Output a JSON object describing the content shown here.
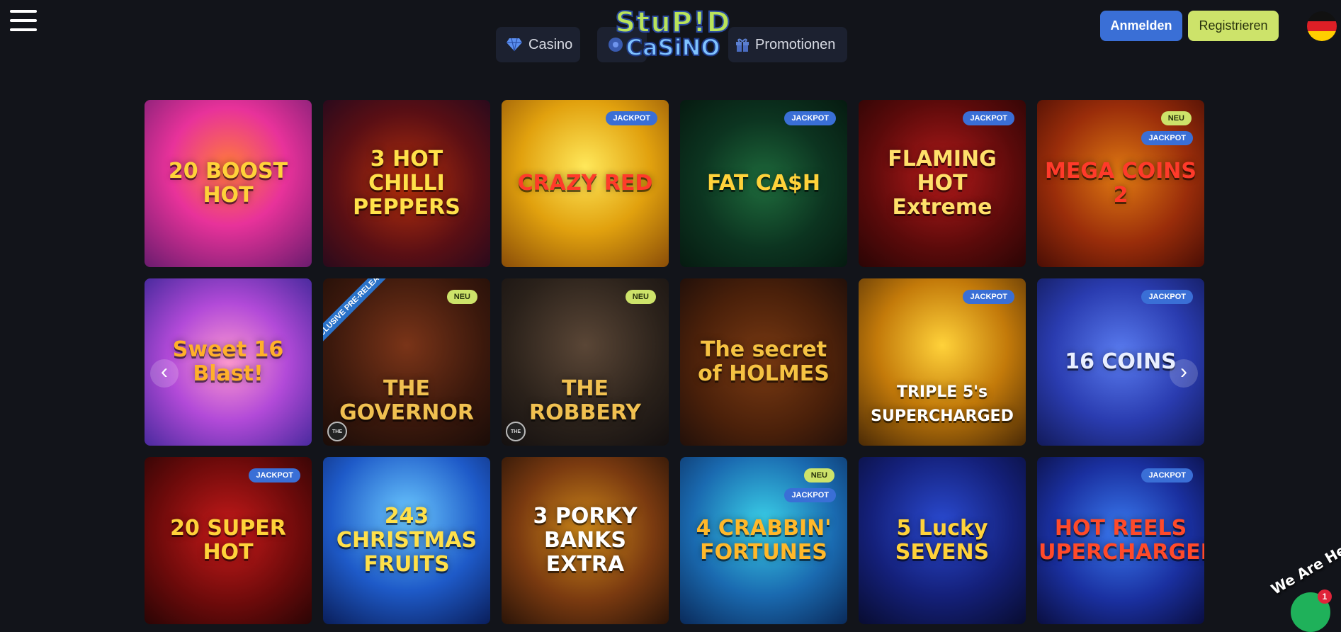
{
  "header": {
    "nav": [
      {
        "label": "Casino",
        "icon": "diamond-icon"
      },
      {
        "label": "",
        "icon": "live-icon"
      },
      {
        "label": "Promotionen",
        "icon": "gift-icon"
      }
    ],
    "logo": {
      "line1": "StuP!D",
      "line2": "CaSiNO"
    },
    "login_label": "Anmelden",
    "register_label": "Registrieren",
    "language": "German",
    "colors": {
      "accent_blue": "#3a6fd6",
      "accent_lime": "#cde36a",
      "background": "#12141a"
    }
  },
  "games": [
    {
      "title": "20 BOOST HOT",
      "badges": []
    },
    {
      "title": "3 HOT CHILLI PEPPERS",
      "badges": []
    },
    {
      "title": "CRAZY RED",
      "badges": [
        "JACKPOT"
      ]
    },
    {
      "title": "FAT CA$H",
      "badges": [
        "JACKPOT"
      ]
    },
    {
      "title": "FLAMING HOT Extreme",
      "badges": [
        "JACKPOT"
      ]
    },
    {
      "title": "MEGA COINS 2",
      "badges": [
        "NEU",
        "JACKPOT"
      ]
    },
    {
      "title": "Sweet 16 Blast!",
      "badges": []
    },
    {
      "title": "THE GOVERNOR",
      "badges": [
        "NEU"
      ],
      "ribbon": "EXCLUSIVE PRE-RELEASE"
    },
    {
      "title": "THE ROBBERY",
      "badges": [
        "NEU"
      ]
    },
    {
      "title": "The secret of HOLMES",
      "badges": []
    },
    {
      "title": "TRIPLE 5's SUPERCHARGED",
      "badges": [
        "JACKPOT"
      ]
    },
    {
      "title": "16 COINS",
      "badges": [
        "JACKPOT"
      ]
    },
    {
      "title": "20 SUPER HOT",
      "badges": [
        "JACKPOT"
      ]
    },
    {
      "title": "243 CHRISTMAS FRUITS",
      "badges": []
    },
    {
      "title": "3 PORKY BANKS EXTRA",
      "badges": []
    },
    {
      "title": "4 CRABBIN' FORTUNES",
      "badges": [
        "NEU",
        "JACKPOT"
      ]
    },
    {
      "title": "5 Lucky SEVENS",
      "badges": []
    },
    {
      "title": "HOT REELS SUPERCHARGED",
      "badges": [
        "JACKPOT"
      ]
    }
  ],
  "carousel": {
    "prev_icon": "chevron-left-icon",
    "next_icon": "chevron-right-icon"
  },
  "chat": {
    "label": "We Are Here",
    "unread_count": "1"
  }
}
